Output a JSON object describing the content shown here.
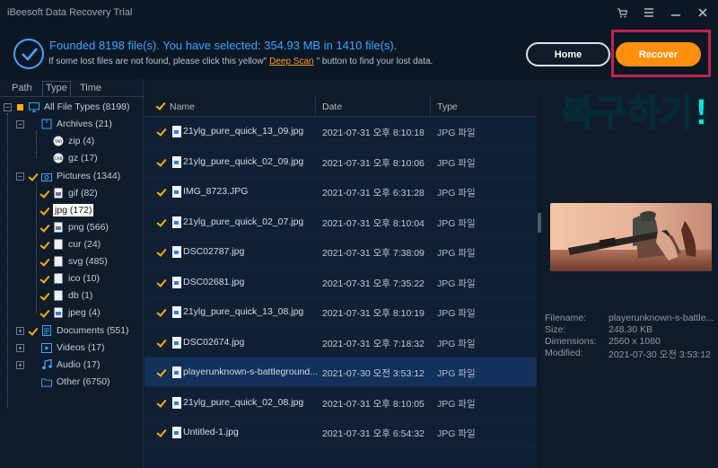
{
  "app": {
    "title": "iBeesoft Data Recovery Trial"
  },
  "window_controls": [
    "cart-icon",
    "menu-icon",
    "minimize-icon",
    "close-icon"
  ],
  "header": {
    "found_text": "Founded 8198 file(s).  You have selected: 354.93 MB in 1410 file(s).",
    "hint_before": "If some lost files are not found, please click this yellow\"",
    "hint_link": "Deep Scan",
    "hint_after": "\" button to find your lost data.",
    "home_label": "Home",
    "recover_label": "Recover"
  },
  "overlay_caption": "복구하기!",
  "tabs": [
    {
      "label": "Path"
    },
    {
      "label": "Type"
    },
    {
      "label": "Time"
    }
  ],
  "tree": {
    "root": "All File Types (8198)",
    "archives": "Archives (21)",
    "zip": "zip (4)",
    "gz": "gz (17)",
    "pictures": "Pictures (1344)",
    "gif": "gif (82)",
    "jpg": "jpg (172)",
    "png": "png (566)",
    "cur": "cur (24)",
    "svg": "svg (485)",
    "ico": "ico (10)",
    "db": "db (1)",
    "jpeg": "jpeg (4)",
    "documents": "Documents (551)",
    "videos": "Videos (17)",
    "audio": "Audio (17)",
    "other": "Other (6750)"
  },
  "list": {
    "columns": {
      "name": "Name",
      "date": "Date",
      "type": "Type"
    },
    "rows": [
      {
        "name": "21ylg_pure_quick_13_09.jpg",
        "date": "2021-07-31 오후 8:10:18",
        "type": "JPG 파일"
      },
      {
        "name": "21ylg_pure_quick_02_09.jpg",
        "date": "2021-07-31 오후 8:10:06",
        "type": "JPG 파일"
      },
      {
        "name": "IMG_8723.JPG",
        "date": "2021-07-31 오후 6:31:28",
        "type": "JPG 파일"
      },
      {
        "name": "21ylg_pure_quick_02_07.jpg",
        "date": "2021-07-31 오후 8:10:04",
        "type": "JPG 파일"
      },
      {
        "name": "DSC02787.jpg",
        "date": "2021-07-31 오후 7:38:09",
        "type": "JPG 파일"
      },
      {
        "name": "DSC02681.jpg",
        "date": "2021-07-31 오후 7:35:22",
        "type": "JPG 파일"
      },
      {
        "name": "21ylg_pure_quick_13_08.jpg",
        "date": "2021-07-31 오후 8:10:19",
        "type": "JPG 파일"
      },
      {
        "name": "DSC02674.jpg",
        "date": "2021-07-31 오후 7:18:32",
        "type": "JPG 파일"
      },
      {
        "name": "playerunknown-s-battleground...",
        "date": "2021-07-30 오전 3:53:12",
        "type": "JPG 파일"
      },
      {
        "name": "21ylg_pure_quick_02_08.jpg",
        "date": "2021-07-31 오후 8:10:05",
        "type": "JPG 파일"
      },
      {
        "name": "Untitled-1.jpg",
        "date": "2021-07-31 오후 6:54:32",
        "type": "JPG 파일"
      }
    ]
  },
  "details": {
    "filename_label": "Filename:",
    "filename": "playerunknown-s-battle...",
    "size_label": "Size:",
    "size": "248.30 KB",
    "dimensions_label": "Dimensions:",
    "dimensions": "2560 x 1080",
    "modified_label": "Modified:",
    "modified": "2021-07-30 오전 3:53:12"
  },
  "colors": {
    "accent_blue": "#3ea6ff",
    "recover_orange": "#ff8f0c",
    "check_yellow": "#ffb000",
    "highlight_frame": "#c0234d",
    "caption_cyan": "#0fe6d9"
  }
}
